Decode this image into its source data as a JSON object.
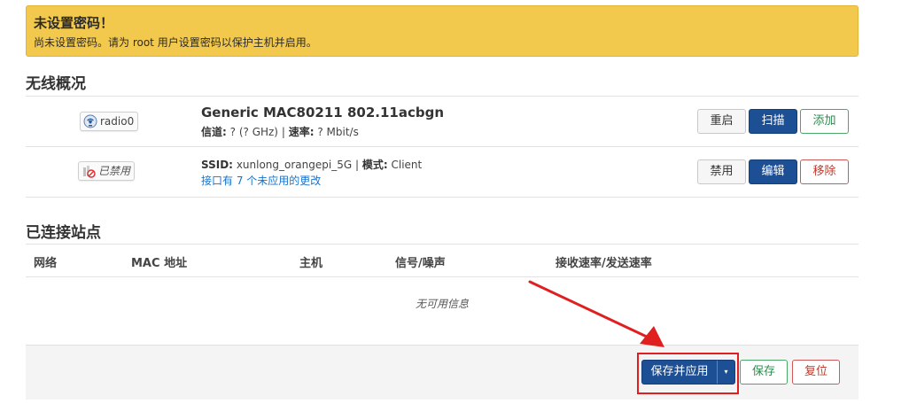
{
  "alert": {
    "title": "未设置密码！",
    "message": "尚未设置密码。请为 root 用户设置密码以保护主机并启用。"
  },
  "wireless": {
    "section_title": "无线概况",
    "device": {
      "badge_label": "radio0",
      "name": "Generic MAC80211 802.11acbgn",
      "channel_label": "信道:",
      "channel_value": "? (? GHz)",
      "sep": "|",
      "rate_label": "速率:",
      "rate_value": "? Mbit/s",
      "buttons": {
        "restart": "重启",
        "scan": "扫描",
        "add": "添加"
      }
    },
    "interface": {
      "badge_label": "已禁用",
      "ssid_label": "SSID:",
      "ssid_value": "xunlong_orangepi_5G",
      "sep": "|",
      "mode_label": "模式:",
      "mode_value": "Client",
      "pending_note": "接口有 7 个未应用的更改",
      "buttons": {
        "disable": "禁用",
        "edit": "编辑",
        "remove": "移除"
      }
    }
  },
  "stations": {
    "section_title": "已连接站点",
    "columns": [
      "网络",
      "MAC 地址",
      "主机",
      "信号/噪声",
      "接收速率/发送速率"
    ],
    "empty_message": "无可用信息"
  },
  "footer": {
    "save_apply": "保存并应用",
    "dropdown_caret": "▾",
    "save": "保存",
    "reset": "复位"
  },
  "colors": {
    "alert_bg": "#f2c94c",
    "primary": "#1d4f95",
    "positive": "#2e8b4f",
    "negative": "#c0392b",
    "link": "#1a73c8",
    "annotation": "#e02020"
  }
}
